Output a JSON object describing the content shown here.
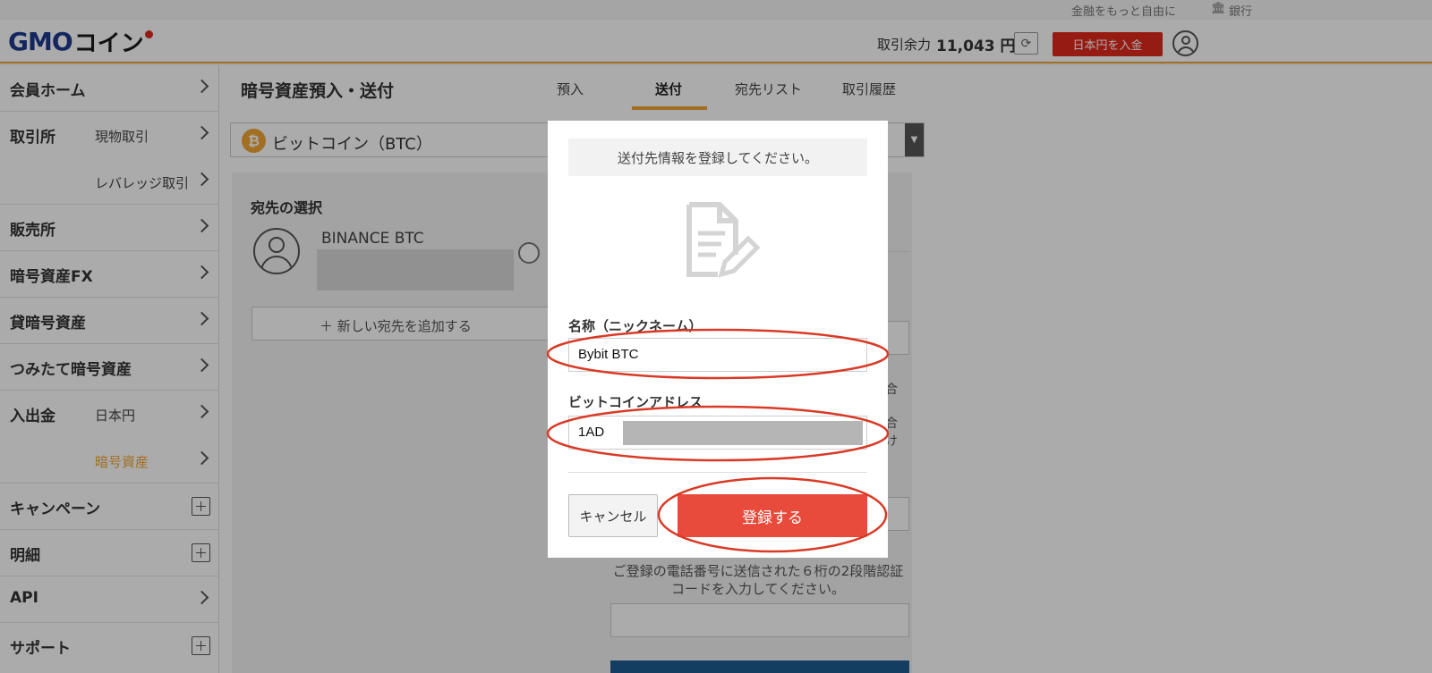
{
  "top_links": {
    "tagline": "金融をもっと自由に",
    "bank": "銀行"
  },
  "header": {
    "logo_main": "GMO",
    "logo_sub": "コイン",
    "balance_label": "取引余力",
    "balance_value": "11,043 円",
    "deposit_button": "日本円を入金"
  },
  "sidebar": {
    "home": "会員ホーム",
    "exchange": "取引所",
    "spot": "現物取引",
    "leverage": "レバレッジ取引",
    "store": "販売所",
    "fx": "暗号資産FX",
    "lending": "貸暗号資産",
    "tsumitate": "つみたて暗号資産",
    "inout": "入出金",
    "jpy": "日本円",
    "crypto": "暗号資産",
    "campaign": "キャンペーン",
    "statement": "明細",
    "api": "API",
    "support": "サポート"
  },
  "main": {
    "title": "暗号資産預入・送付",
    "tabs": [
      "預入",
      "送付",
      "宛先リスト",
      "取引履歴"
    ],
    "active_tab": "送付",
    "coin_icon": "₿",
    "coin_select": "ビットコイン（BTC）",
    "select_arrow": "▼",
    "dest_title": "宛先の選択",
    "dest_name": "BINANCE BTC",
    "add_destination": "＋ 新しい宛先を追加する",
    "sms_text": "ご登録の電話番号に送信された６桁の2段階認証コードを入力してください。",
    "frag_1": "合",
    "frag_2": "合",
    "frag_3": "け"
  },
  "modal": {
    "banner": "送付先情報を登録してください。",
    "name_label": "名称（ニックネーム）",
    "name_value": "Bybit BTC",
    "address_label": "ビットコインアドレス",
    "address_value": "1AD",
    "cancel_button": "キャンセル",
    "register_button": "登録する"
  },
  "colors": {
    "accent_orange": "#f2a534",
    "brand_red": "#e0291c",
    "register_red": "#e84b3c",
    "annotation_red": "#d93a26"
  }
}
